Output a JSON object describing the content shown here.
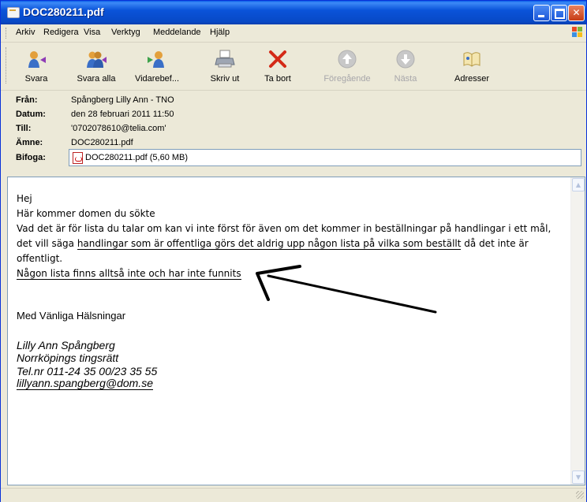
{
  "window": {
    "title": "DOC280211.pdf"
  },
  "menu": {
    "items": [
      "Arkiv",
      "Redigera",
      "Visa",
      "Verktyg",
      "Meddelande",
      "Hjälp"
    ]
  },
  "toolbar": {
    "reply": "Svara",
    "reply_all": "Svara alla",
    "forward": "Vidarebef...",
    "print": "Skriv ut",
    "delete": "Ta bort",
    "previous": "Föregående",
    "next": "Nästa",
    "addresses": "Adresser"
  },
  "header": {
    "from_label": "Från:",
    "from": "Spångberg Lilly Ann - TNO",
    "date_label": "Datum:",
    "date": "den 28 februari 2011 11:50",
    "to_label": "Till:",
    "to": "'0702078610@telia.com'",
    "subject_label": "Ämne:",
    "subject": "DOC280211.pdf",
    "attach_label": "Bifoga:",
    "attachment": "DOC280211.pdf (5,60 MB)"
  },
  "body": {
    "greeting": "Hej",
    "line1": "Här kommer domen du sökte",
    "para_a": "Vad det är för lista du talar om kan vi inte först för även om det kommer in beställningar på handlingar i ett mål, det vill säga ",
    "para_underlined": "handlingar som är offentliga görs det aldrig upp någon lista på vilka som beställt",
    "para_b": " då det inte är offentligt.",
    "conclusion": "Någon lista finns alltså inte och har inte funnits",
    "closing": "Med Vänliga Hälsningar",
    "sig_name": "Lilly Ann Spångberg",
    "sig_org": "Norrköpings tingsrätt",
    "sig_phone": "Tel.nr 011-24 35 00/23 35 55",
    "sig_email": "lillyann.spangberg@dom.se"
  },
  "colors": {
    "titlebar": "#0A53D9",
    "delete_icon": "#D42A17"
  }
}
